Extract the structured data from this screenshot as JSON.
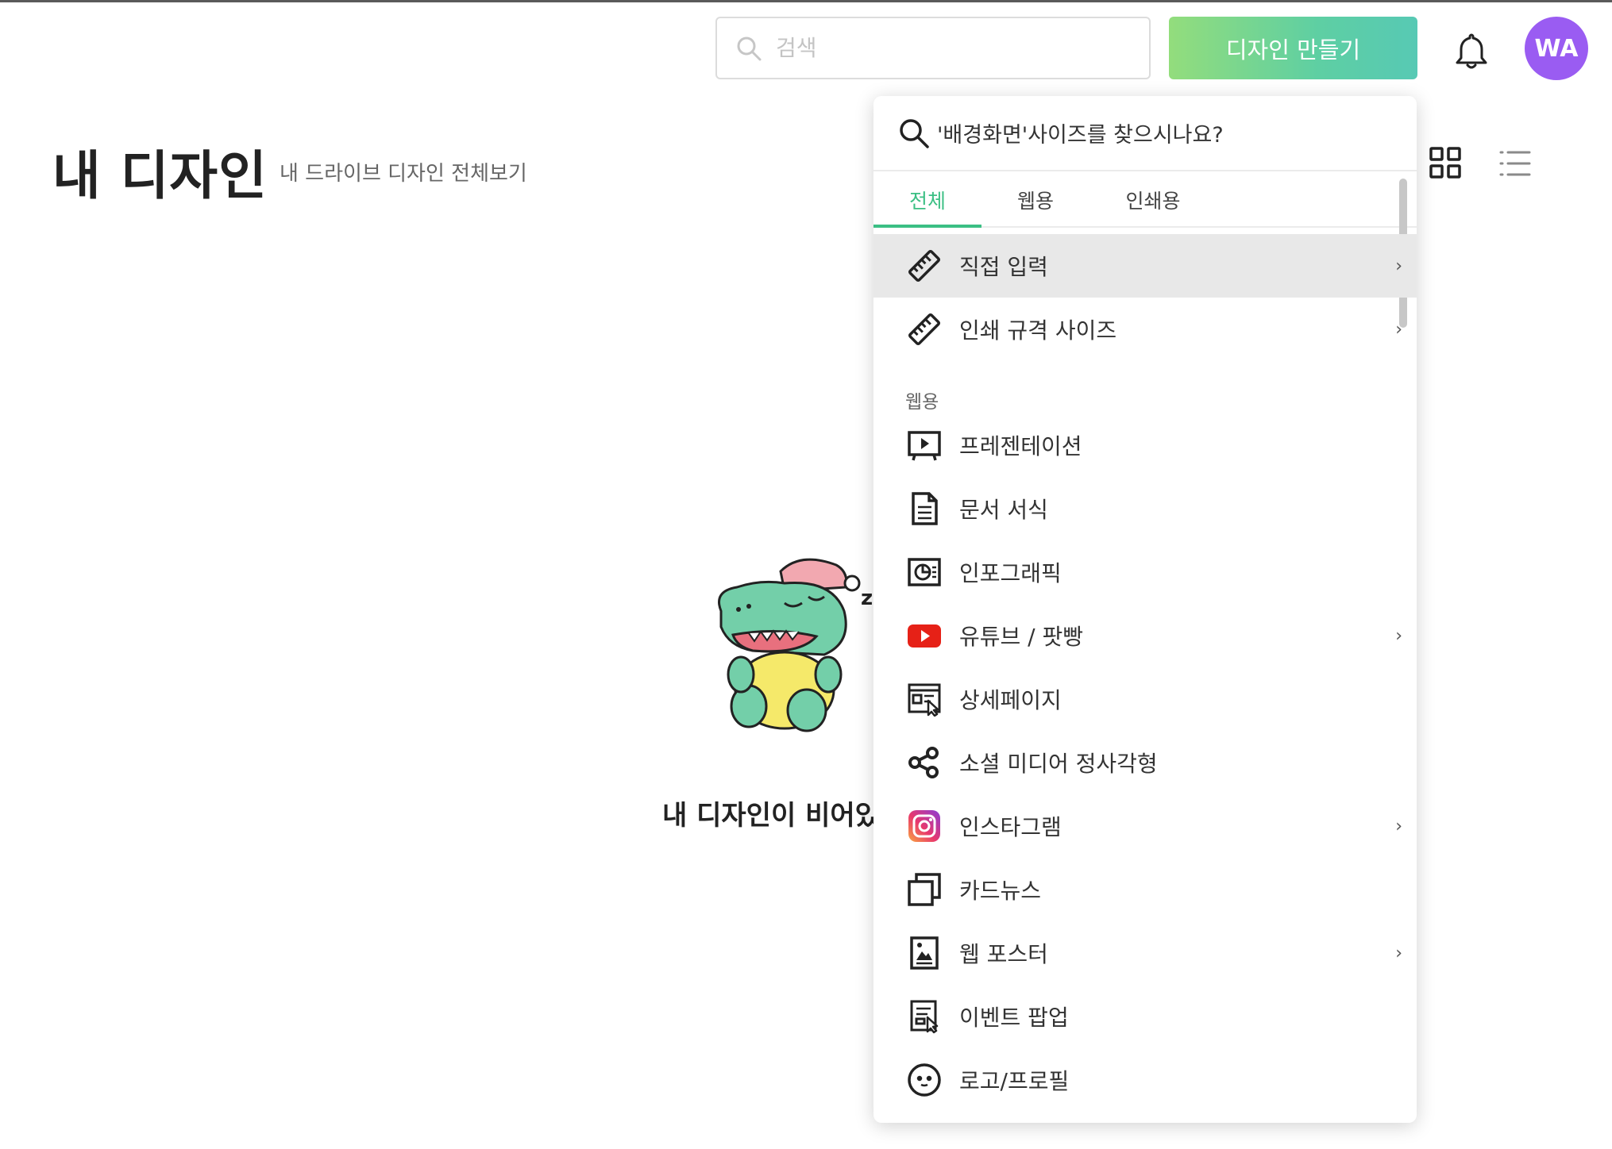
{
  "header": {
    "search_placeholder": "검색",
    "create_button": "디자인 만들기",
    "avatar_initials": "WA"
  },
  "page": {
    "title": "내 디자인",
    "subtitle": "내 드라이브 디자인 전체보기",
    "empty_message": "내 디자인이 비어있"
  },
  "dropdown": {
    "query": "'배경화면'사이즈를 찾으시나요?",
    "tabs": [
      "전체",
      "웹용",
      "인쇄용"
    ],
    "active_tab": "전체",
    "items_top": [
      {
        "label": "직접 입력",
        "icon": "ruler-icon",
        "chevron": true,
        "active": true
      },
      {
        "label": "인쇄 규격 사이즈",
        "icon": "ruler-icon",
        "chevron": true
      }
    ],
    "section_label": "웹용",
    "items_web": [
      {
        "label": "프레젠테이션",
        "icon": "presentation-icon",
        "chevron": false
      },
      {
        "label": "문서 서식",
        "icon": "document-icon",
        "chevron": false
      },
      {
        "label": "인포그래픽",
        "icon": "infographic-icon",
        "chevron": false
      },
      {
        "label": "유튜브 / 팟빵",
        "icon": "youtube-icon",
        "chevron": true
      },
      {
        "label": "상세페이지",
        "icon": "detail-page-icon",
        "chevron": false
      },
      {
        "label": "소셜 미디어 정사각형",
        "icon": "share-icon",
        "chevron": false
      },
      {
        "label": "인스타그램",
        "icon": "instagram-icon",
        "chevron": true
      },
      {
        "label": "카드뉴스",
        "icon": "card-news-icon",
        "chevron": false
      },
      {
        "label": "웹 포스터",
        "icon": "poster-icon",
        "chevron": true
      },
      {
        "label": "이벤트 팝업",
        "icon": "popup-icon",
        "chevron": false
      },
      {
        "label": "로고/프로필",
        "icon": "smiley-icon",
        "chevron": false
      }
    ]
  },
  "colors": {
    "accent_green": "#3bbf84",
    "avatar_purple": "#9a5cf2",
    "youtube_red": "#e62117"
  }
}
